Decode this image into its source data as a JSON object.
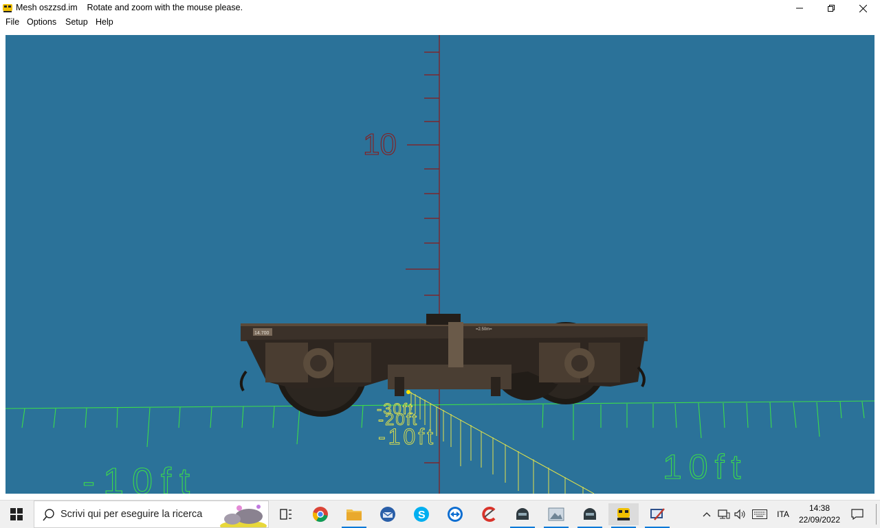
{
  "window": {
    "app_name": "Mesh oszzsd.im",
    "hint": "Rotate and zoom with the mouse please."
  },
  "menu": [
    "File",
    "Options",
    "Setup",
    "Help"
  ],
  "scene": {
    "vertical_axis_label": "10",
    "left_ground_label": "-10ft",
    "right_ground_label": "10ft",
    "depth_labels": [
      "-30ft",
      "-20ft",
      "-10ft"
    ],
    "bogie_plate_left": "14.700",
    "bogie_plate_right": "=2.50m=",
    "colors": {
      "background": "#2b7299",
      "vertical_axis": "#8b1a1a",
      "ground_grid": "#3ddc4a",
      "depth_grid": "#e3e34a"
    }
  },
  "taskbar": {
    "search_placeholder": "Scrivi qui per eseguire la ricerca",
    "language": "ITA",
    "time": "14:38",
    "date": "22/09/2022",
    "pinned_apps": [
      "task-view",
      "chrome",
      "file-explorer",
      "thunderbird",
      "skype",
      "teamviewer",
      "ccleaner",
      "trainz-a",
      "photos",
      "trainz-b",
      "mesh-viewer",
      "remote-tool"
    ]
  }
}
